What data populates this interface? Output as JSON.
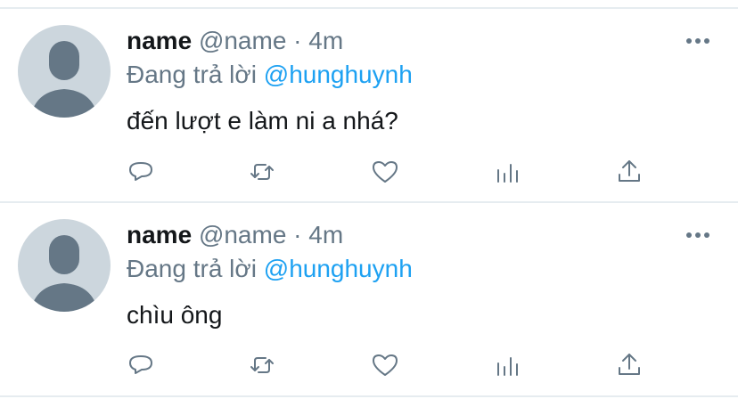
{
  "tweets": [
    {
      "display_name": "name",
      "meta": "@name · 4m",
      "reply_prefix": "Đang trả lời",
      "reply_mention": "@hunghuynh",
      "text": "đến lượt e làm ni a nhá?"
    },
    {
      "display_name": "name",
      "meta": "@name · 4m",
      "reply_prefix": "Đang trả lời",
      "reply_mention": "@hunghuynh",
      "text": "chìu ông"
    }
  ],
  "icons": {
    "reply": "reply-icon",
    "retweet": "retweet-icon",
    "like": "heart-icon",
    "analytics": "analytics-icon",
    "share": "share-icon",
    "more": "more-icon"
  },
  "colors": {
    "text": "#14171a",
    "secondary": "#657786",
    "mention": "#1da1f2",
    "avatar": "#ccd6dd",
    "avatar_figure": "#657786",
    "divider": "#e6ecf0"
  }
}
